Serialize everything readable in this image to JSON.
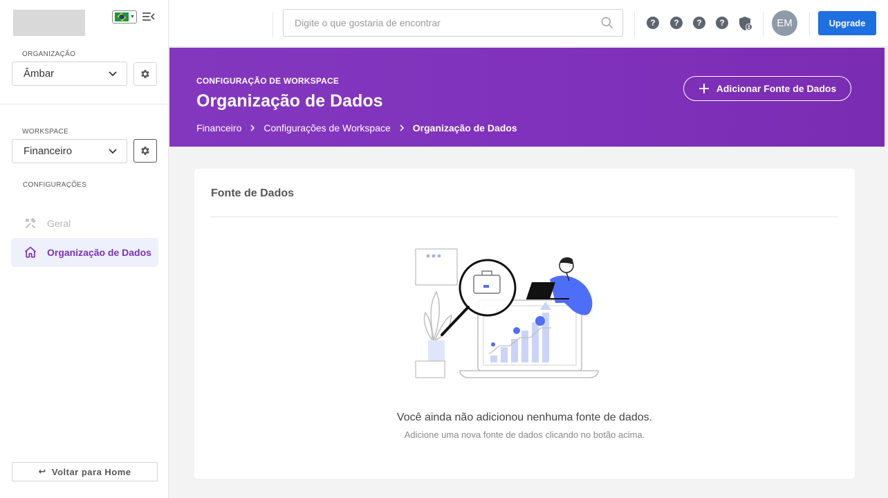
{
  "sidebar": {
    "organization_label": "ORGANIZAÇÃO",
    "organization_value": "Âmbar",
    "workspace_label": "WORKSPACE",
    "workspace_value": "Financeiro",
    "settings_label": "CONFIGURAÇÕES",
    "items": [
      {
        "label": "Geral",
        "icon": "tools-icon",
        "state": "disabled"
      },
      {
        "label": "Organização de Dados",
        "icon": "home-icon",
        "state": "active"
      }
    ],
    "back_label": "Voltar para Home"
  },
  "topbar": {
    "search_placeholder": "Digite o que gostaria de encontrar",
    "avatar_initials": "EM",
    "upgrade_label": "Upgrade"
  },
  "banner": {
    "eyebrow": "CONFIGURAÇÃO DE WORKSPACE",
    "title": "Organização de Dados",
    "breadcrumb": [
      "Financeiro",
      "Configurações de Workspace",
      "Organização de Dados"
    ],
    "add_button_label": "Adicionar Fonte de Dados"
  },
  "card": {
    "title": "Fonte de Dados",
    "empty_title": "Você ainda não adicionou nenhuma fonte de dados.",
    "empty_subtitle": "Adicione uma nova fonte de dados clicando no botão acima."
  },
  "colors": {
    "brand_purple": "#8337be",
    "primary_blue": "#1e6fe0",
    "active_nav_bg": "#eef1fb",
    "illustration_blue": "#4f6ef7"
  }
}
